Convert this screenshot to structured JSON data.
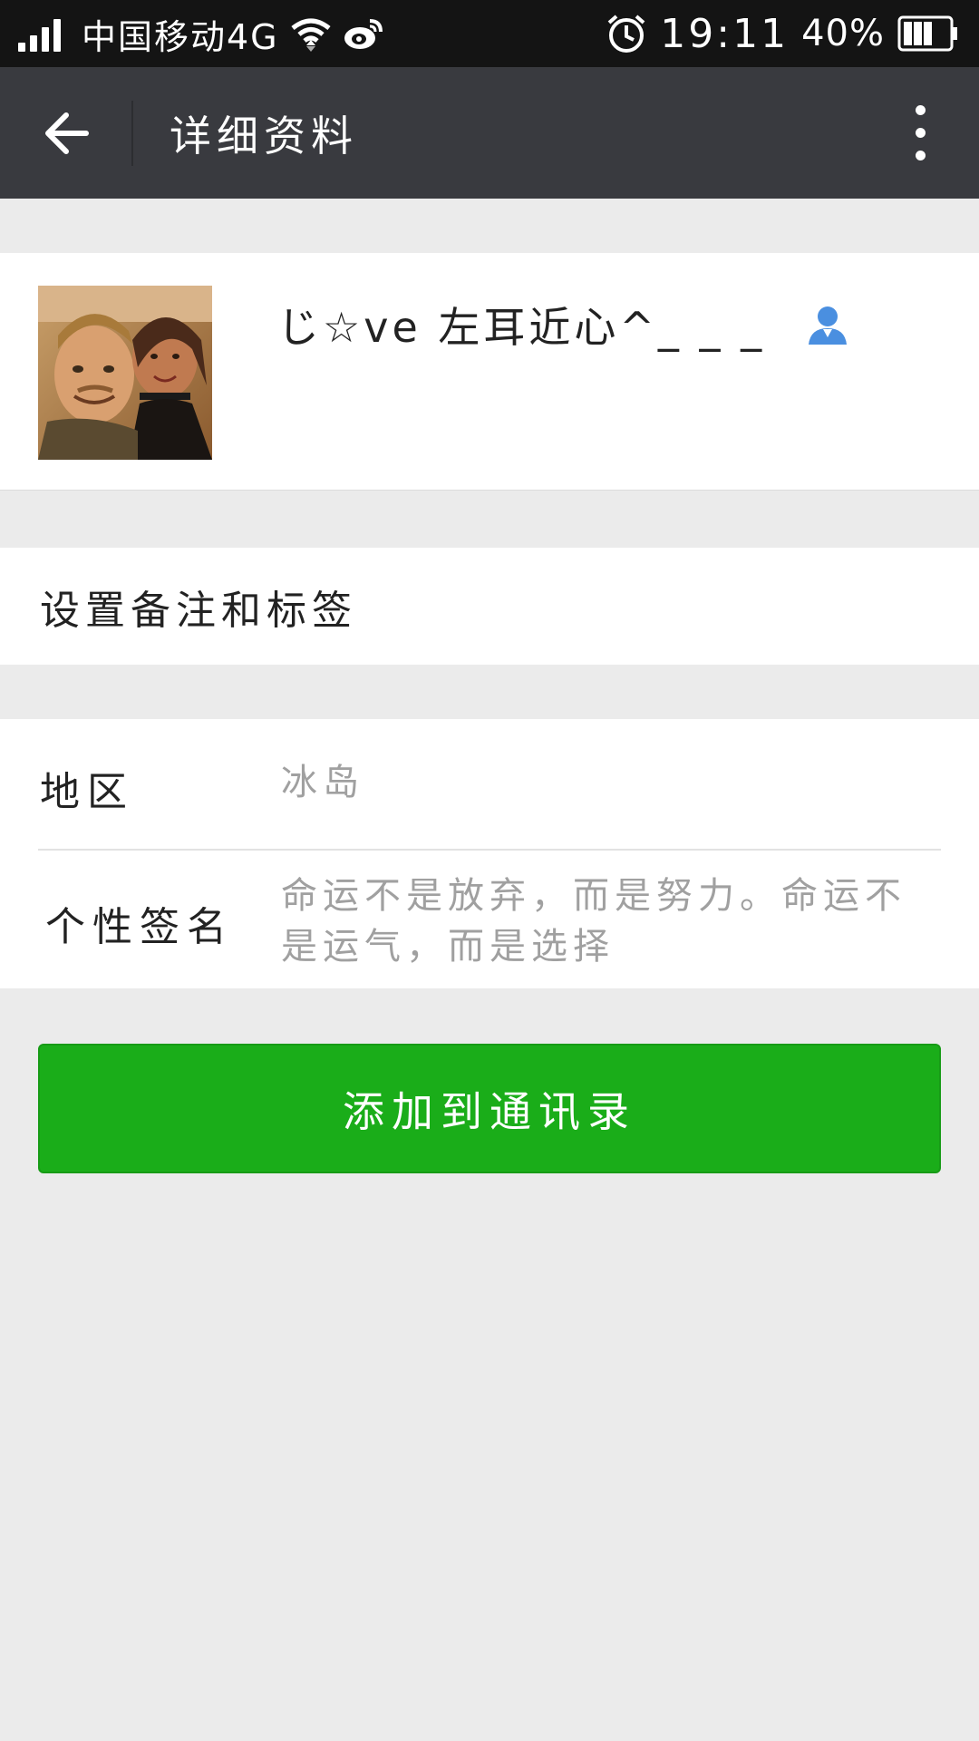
{
  "status_bar": {
    "carrier": "中国移动4G",
    "time": "19:11",
    "battery": "40%",
    "icons": [
      "signal-icon",
      "wifi-icon",
      "weibo-icon",
      "alarm-icon",
      "battery-icon"
    ]
  },
  "title_bar": {
    "title": "详细资料",
    "back_icon": "arrow-left-icon",
    "more_icon": "more-vertical-icon"
  },
  "profile": {
    "nickname": "じ☆ve 左耳近心^_ _ _",
    "contact_icon": "person-icon",
    "accent_color": "#4a8fe0"
  },
  "remark": {
    "label": "设置备注和标签"
  },
  "info": {
    "region_label": "地区",
    "region_value": "冰岛",
    "signature_label": "个性签名",
    "signature_value": "命运不是放弃，而是努力。命运不是运气，而是选择"
  },
  "actions": {
    "add_label": "添加到通讯录",
    "add_color": "#1aad19"
  }
}
